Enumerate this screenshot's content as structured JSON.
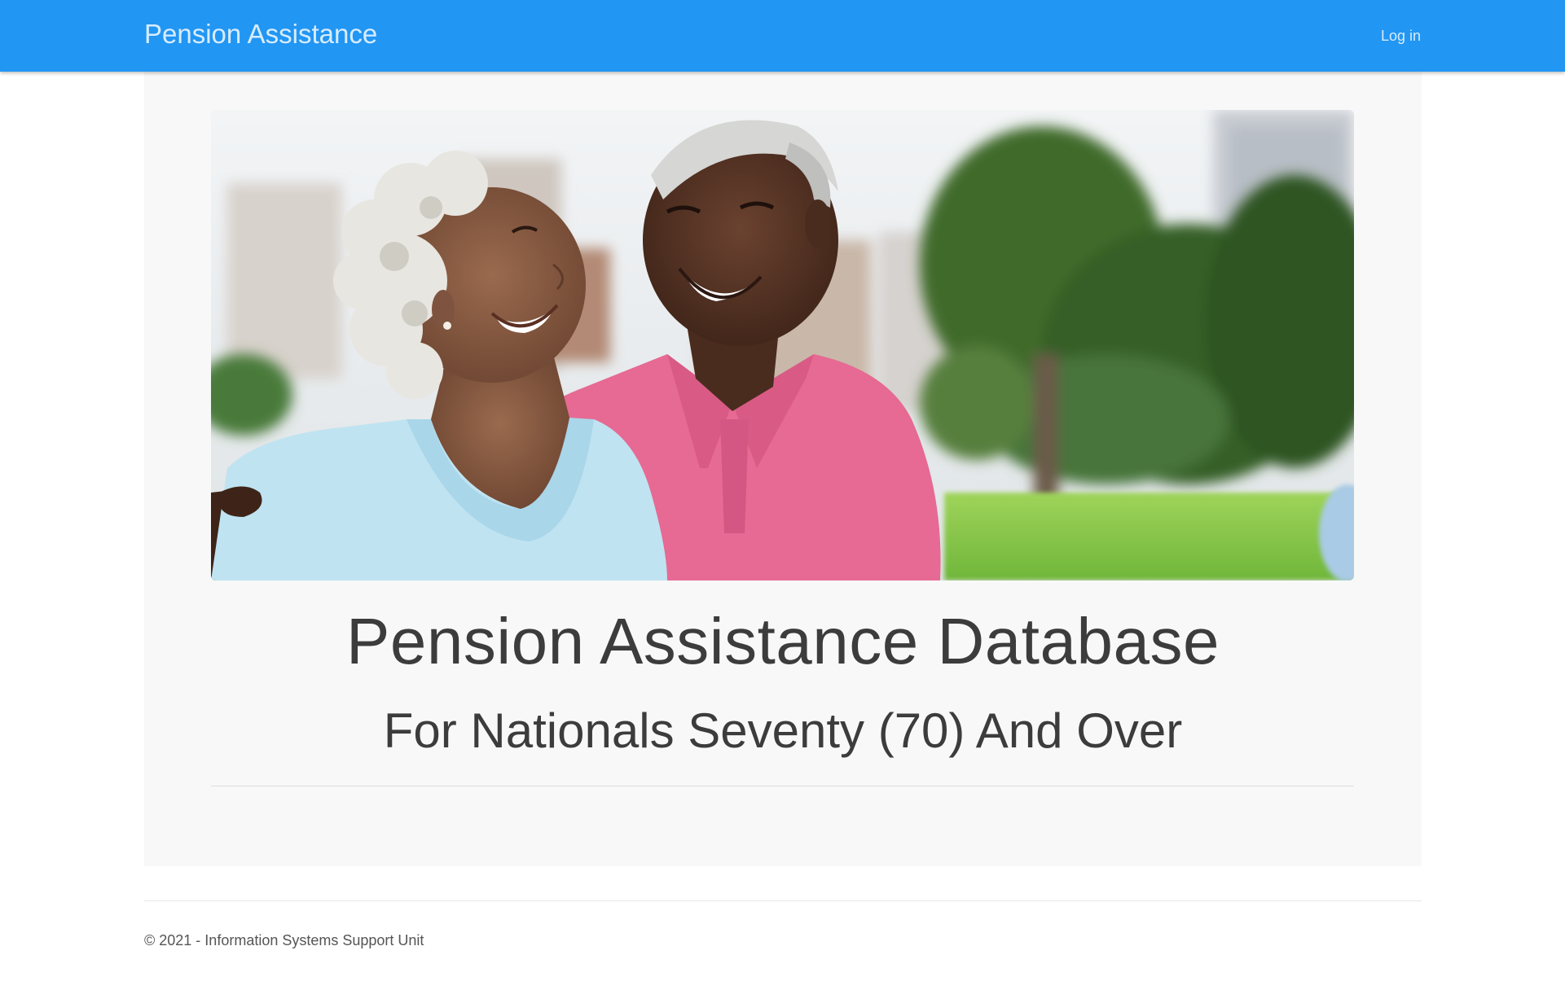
{
  "navbar": {
    "brand": "Pension Assistance",
    "login_label": "Log in",
    "color": "#2196f3"
  },
  "hero": {
    "title": "Pension Assistance Database",
    "subtitle": "For Nationals Seventy (70) And Over"
  },
  "footer": {
    "text": "© 2021 - Information Systems Support Unit"
  }
}
